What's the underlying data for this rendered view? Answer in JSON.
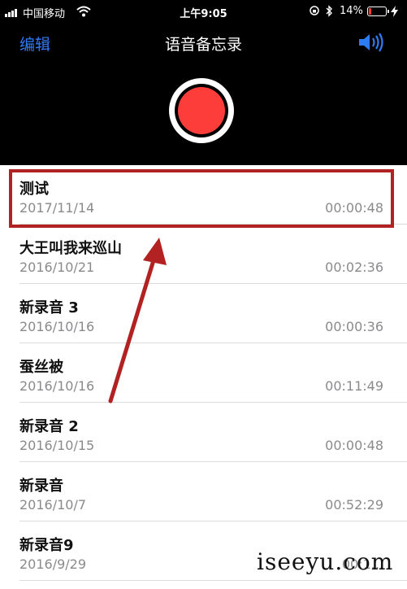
{
  "status_bar": {
    "carrier": "中国移动",
    "time": "上午9:05",
    "battery": "14%",
    "battery_level": 0.14,
    "icons": [
      "signal-icon",
      "wifi-icon",
      "orientation-lock-icon",
      "bluetooth-icon",
      "battery-icon",
      "charging-icon"
    ]
  },
  "nav": {
    "edit_label": "编辑",
    "title": "语音备忘录",
    "speaker_icon": "speaker-icon"
  },
  "colors": {
    "accent": "#2f7bf5",
    "record": "#fc3d39",
    "annotation": "#b22222"
  },
  "recordings": [
    {
      "name": "测试",
      "date": "2017/11/14",
      "duration": "00:00:48"
    },
    {
      "name": "大王叫我来巡山",
      "date": "2016/10/21",
      "duration": "00:02:36"
    },
    {
      "name": "新录音 3",
      "date": "2016/10/16",
      "duration": "00:00:36"
    },
    {
      "name": "蚕丝被",
      "date": "2016/10/16",
      "duration": "00:11:49"
    },
    {
      "name": "新录音 2",
      "date": "2016/10/15",
      "duration": "00:00:48"
    },
    {
      "name": "新录音",
      "date": "2016/10/7",
      "duration": "00:52:29"
    },
    {
      "name": "新录音9",
      "date": "2016/9/29",
      "duration": "00:1..."
    }
  ],
  "watermark": "iseeyu.com"
}
